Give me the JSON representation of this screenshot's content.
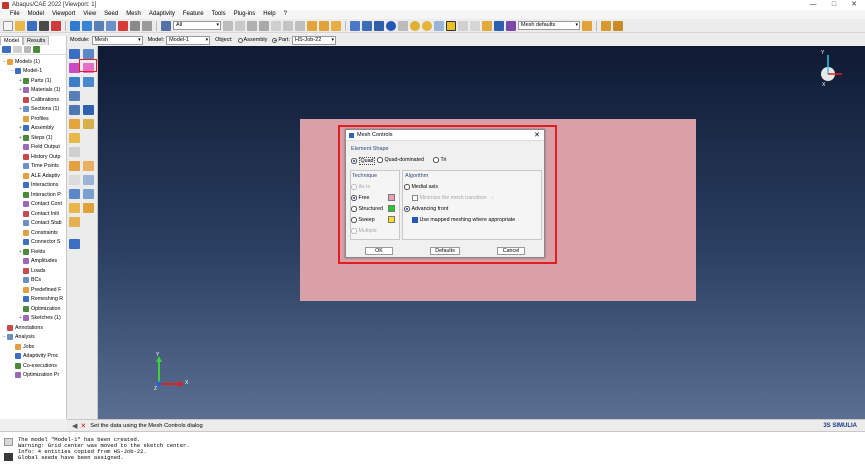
{
  "window": {
    "title": "Abaqus/CAE 2022 [Viewport: 1]",
    "minimize": "—",
    "maximize": "□",
    "close": "✕"
  },
  "menubar": [
    "File",
    "Model",
    "Viewport",
    "View",
    "Seed",
    "Mesh",
    "Adaptivity",
    "Feature",
    "Tools",
    "Plug-ins",
    "Help",
    "?"
  ],
  "toolbar": {
    "render_select": "All",
    "mesh_defaults": "Mesh defaults"
  },
  "context": {
    "module_label": "Module:",
    "module_value": "Mesh",
    "model_label": "Model:",
    "model_value": "Model-1",
    "object_label": "Object:",
    "assembly_label": "Assembly",
    "part_label": "Part:",
    "part_value": "HS-Job-22"
  },
  "model_tree": {
    "tabs": [
      "Model",
      "Results"
    ],
    "items": [
      {
        "label": "Models (1)",
        "indent": 0,
        "expander": "−"
      },
      {
        "label": "Model-1",
        "indent": 1,
        "expander": "−"
      },
      {
        "label": "Parts (1)",
        "indent": 2,
        "expander": "+"
      },
      {
        "label": "Materials (1)",
        "indent": 2,
        "expander": "+"
      },
      {
        "label": "Calibrations",
        "indent": 2,
        "expander": ""
      },
      {
        "label": "Sections (1)",
        "indent": 2,
        "expander": "+"
      },
      {
        "label": "Profiles",
        "indent": 2,
        "expander": ""
      },
      {
        "label": "Assembly",
        "indent": 2,
        "expander": "+"
      },
      {
        "label": "Steps (1)",
        "indent": 2,
        "expander": "+"
      },
      {
        "label": "Field Output",
        "indent": 2,
        "expander": ""
      },
      {
        "label": "History Outp",
        "indent": 2,
        "expander": ""
      },
      {
        "label": "Time Points",
        "indent": 2,
        "expander": ""
      },
      {
        "label": "ALE Adaptiv",
        "indent": 2,
        "expander": ""
      },
      {
        "label": "Interactions",
        "indent": 2,
        "expander": ""
      },
      {
        "label": "Interaction P",
        "indent": 2,
        "expander": ""
      },
      {
        "label": "Contact Cont",
        "indent": 2,
        "expander": ""
      },
      {
        "label": "Contact Initi",
        "indent": 2,
        "expander": ""
      },
      {
        "label": "Contact Stab",
        "indent": 2,
        "expander": ""
      },
      {
        "label": "Constraints",
        "indent": 2,
        "expander": ""
      },
      {
        "label": "Connector S",
        "indent": 2,
        "expander": ""
      },
      {
        "label": "Fields",
        "indent": 2,
        "expander": "+"
      },
      {
        "label": "Amplitudes",
        "indent": 2,
        "expander": ""
      },
      {
        "label": "Loads",
        "indent": 2,
        "expander": ""
      },
      {
        "label": "BCs",
        "indent": 2,
        "expander": ""
      },
      {
        "label": "Predefined F",
        "indent": 2,
        "expander": ""
      },
      {
        "label": "Remeshing R",
        "indent": 2,
        "expander": ""
      },
      {
        "label": "Optimization",
        "indent": 2,
        "expander": ""
      },
      {
        "label": "Sketches (1)",
        "indent": 2,
        "expander": "+"
      },
      {
        "label": "Annotations",
        "indent": 0,
        "expander": ""
      },
      {
        "label": "Analysis",
        "indent": 0,
        "expander": "−"
      },
      {
        "label": "Jobs",
        "indent": 1,
        "expander": ""
      },
      {
        "label": "Adaptivity Proc",
        "indent": 1,
        "expander": ""
      },
      {
        "label": "Co-executions",
        "indent": 1,
        "expander": ""
      },
      {
        "label": "Optimization Pr",
        "indent": 1,
        "expander": ""
      }
    ]
  },
  "dialog": {
    "title": "Mesh Controls",
    "close": "✕",
    "element_shape": {
      "title": "Element Shape",
      "options": [
        "Quad",
        "Quad-dominated",
        "Tri"
      ],
      "selected": "Quad"
    },
    "technique": {
      "title": "Technique",
      "options": [
        "As is",
        "Free",
        "Structured",
        "Sweep",
        "Multiple"
      ],
      "selected": "Free",
      "colors": {
        "free": "#f0a0b4",
        "structured": "#22cc22",
        "sweep": "#f0e020"
      }
    },
    "algorithm": {
      "title": "Algorithm",
      "medial_axis": "Medial axis",
      "minimize_transition": "Minimize the mesh transition",
      "advancing_front": "Advancing front",
      "use_mapped": "Use mapped meshing where appropriate",
      "selected": "Advancing front"
    },
    "buttons": {
      "ok": "OK",
      "defaults": "Defaults",
      "cancel": "Cancel"
    }
  },
  "triad": {
    "top_y": "Y",
    "top_x": "X",
    "bottom_y": "Y",
    "bottom_x": "X",
    "bottom_z": "Z"
  },
  "prompt": {
    "text": "Set the data using the Mesh Controls dialog"
  },
  "brand": "3S SIMULIA",
  "messages": [
    "The model \"Model-1\" has been created.",
    "Warning: Grid center was moved to the sketch center.",
    "Info: 4 entities copied from HS-Job-22.",
    "Global seeds have been assigned."
  ]
}
